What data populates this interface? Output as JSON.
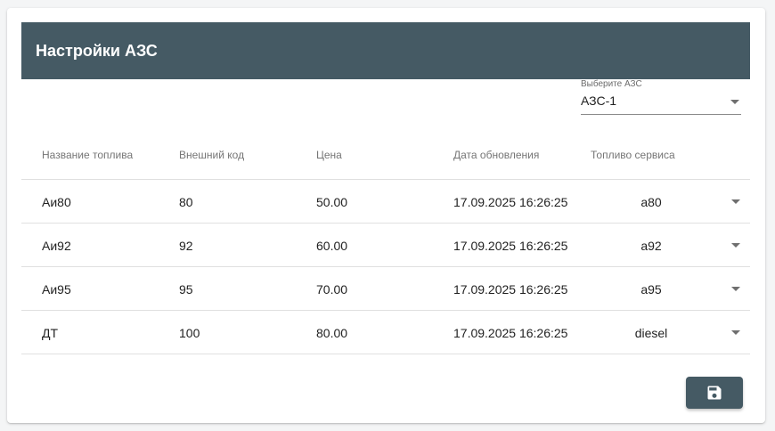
{
  "header": {
    "title": "Настройки АЗС"
  },
  "station": {
    "label": "Выберите АЗС",
    "value": "АЗС-1"
  },
  "table": {
    "columns": [
      "Название топлива",
      "Внешний код",
      "Цена",
      "Дата обновления",
      "Топливо сервиса"
    ],
    "rows": [
      {
        "name": "Аи80",
        "code": "80",
        "price": "50.00",
        "updated": "17.09.2025 16:26:25",
        "service_fuel": "a80"
      },
      {
        "name": "Аи92",
        "code": "92",
        "price": "60.00",
        "updated": "17.09.2025 16:26:25",
        "service_fuel": "a92"
      },
      {
        "name": "Аи95",
        "code": "95",
        "price": "70.00",
        "updated": "17.09.2025 16:26:25",
        "service_fuel": "a95"
      },
      {
        "name": "ДТ",
        "code": "100",
        "price": "80.00",
        "updated": "17.09.2025 16:26:25",
        "service_fuel": "diesel"
      }
    ]
  },
  "actions": {
    "save_icon": "floppy-disk-icon"
  },
  "colors": {
    "header_bg": "#455a64",
    "button_bg": "#455a64"
  }
}
